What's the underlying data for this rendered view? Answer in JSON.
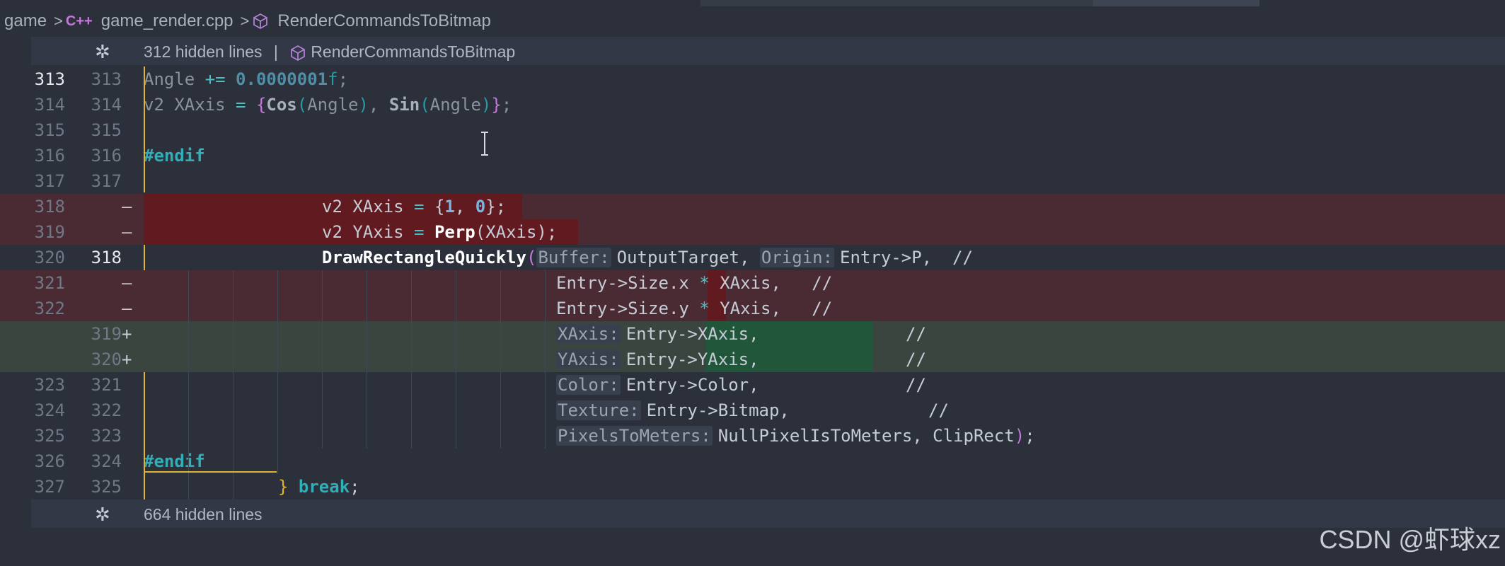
{
  "breadcrumb": {
    "folder": "game",
    "file": "game_render.cpp",
    "file_icon": "C++",
    "symbol": "RenderCommandsToBitmap"
  },
  "hidden_top": {
    "text": "312 hidden lines",
    "divider": "|",
    "symbol": "RenderCommandsToBitmap"
  },
  "hidden_bottom": {
    "text": "664 hidden lines"
  },
  "lines": [
    {
      "old": "313",
      "new": "313",
      "mark": ""
    },
    {
      "old": "314",
      "new": "314",
      "mark": ""
    },
    {
      "old": "315",
      "new": "315",
      "mark": ""
    },
    {
      "old": "316",
      "new": "316",
      "mark": ""
    },
    {
      "old": "317",
      "new": "317",
      "mark": ""
    },
    {
      "old": "318",
      "new": "",
      "mark": "—"
    },
    {
      "old": "319",
      "new": "",
      "mark": "—"
    },
    {
      "old": "320",
      "new": "318",
      "mark": ""
    },
    {
      "old": "321",
      "new": "",
      "mark": "—"
    },
    {
      "old": "322",
      "new": "",
      "mark": "—"
    },
    {
      "old": "",
      "new": "319",
      "mark": "+"
    },
    {
      "old": "",
      "new": "320",
      "mark": "+"
    },
    {
      "old": "323",
      "new": "321",
      "mark": ""
    },
    {
      "old": "324",
      "new": "322",
      "mark": ""
    },
    {
      "old": "325",
      "new": "323",
      "mark": ""
    },
    {
      "old": "326",
      "new": "324",
      "mark": ""
    },
    {
      "old": "327",
      "new": "325",
      "mark": ""
    }
  ],
  "code": {
    "l1_a": "Angle ",
    "l1_op": "+=",
    "l1_num": " 0.0000001",
    "l1_f": "f",
    "l1_end": ";",
    "l2_a": "v2 XAxis ",
    "l2_eq": "=",
    "l2_sp": " ",
    "l2_ob": "{",
    "l2_cos": "Cos",
    "l2_p1": "(",
    "l2_ang1": "Angle",
    "l2_p2": ")",
    "l2_comma": ", ",
    "l2_sin": "Sin",
    "l2_p3": "(",
    "l2_ang2": "Angle",
    "l2_p4": ")",
    "l2_cb": "}",
    "l2_end": ";",
    "l4": "#endif",
    "l6_a": "v2 XAxis ",
    "l6_eq": "=",
    "l6_ob": " {",
    "l6_n1": "1",
    "l6_c": ", ",
    "l6_n2": "0",
    "l6_cb": "};",
    "l7_a": "v2 YAxis ",
    "l7_eq": "=",
    "l7_sp": " ",
    "l7_fn": "Perp",
    "l7_arg": "(XAxis);",
    "l8_fn": "DrawRectangleQuickly",
    "l8_p": "(",
    "l8_h1": "Buffer:",
    "l8_v1": "OutputTarget, ",
    "l8_h2": "Origin:",
    "l8_v2": "Entry->P,  //",
    "l9_a": "Entry->Size.x ",
    "l9_op": "*",
    "l9_b": " XAxis,   //",
    "l10_a": "Entry->Size.y ",
    "l10_op": "*",
    "l10_b": " YAxis,   //",
    "l11_h": "XAxis:",
    "l11_v": "Entry->XAxis,",
    "l11_c": "//",
    "l12_h": "YAxis:",
    "l12_v": "Entry->YAxis,",
    "l12_c": "//",
    "l13_h": "Color:",
    "l13_v": "Entry->Color,",
    "l13_c": "//",
    "l14_h": "Texture:",
    "l14_v": "Entry->Bitmap,",
    "l14_c": "//",
    "l15_h": "PixelsToMeters:",
    "l15_v": "NullPixelIsToMeters, ClipRect",
    "l15_p": ")",
    "l15_e": ";",
    "l16": "#endif",
    "l17_b": "}",
    "l17_kw": " break",
    "l17_e": ";"
  },
  "watermark": "CSDN @虾球xz",
  "colors": {
    "background": "#2b303b",
    "deleted_line": "#4a2b33",
    "deleted_strong": "#611a1f",
    "added_line": "#3a4540",
    "added_strong": "#22563a",
    "change_bar": "#e0b52e",
    "keyword": "#2fb0b9"
  }
}
